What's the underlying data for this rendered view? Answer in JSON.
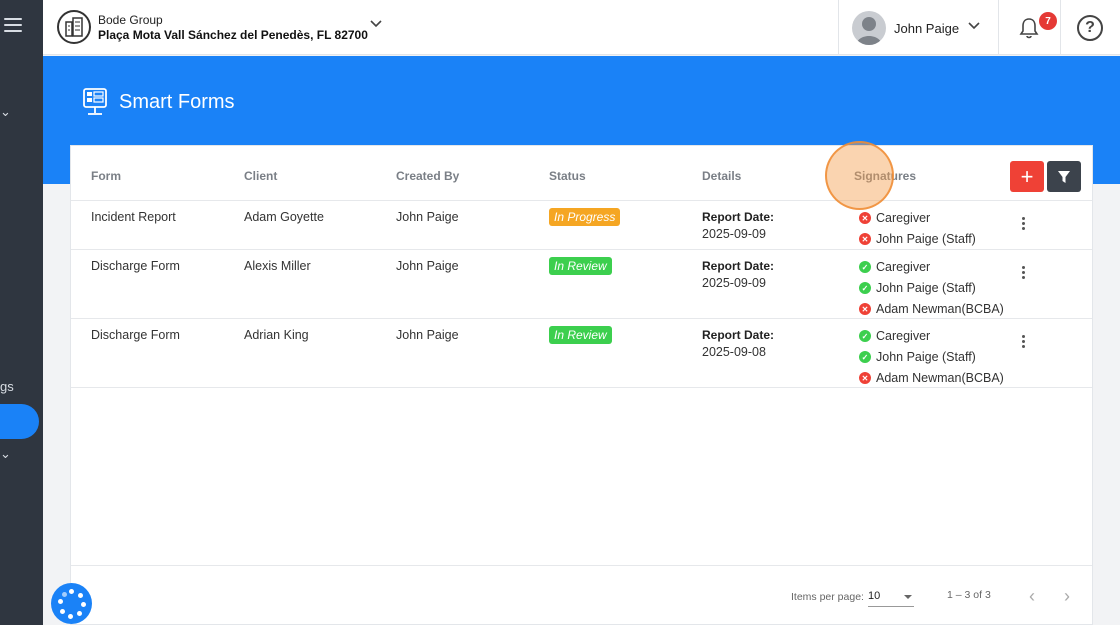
{
  "org": {
    "name": "Bode Group",
    "address": "Plaça Mota Vall Sánchez del Penedès, FL 82700"
  },
  "user": {
    "name": "John Paige"
  },
  "notifications": {
    "count": "7"
  },
  "help": {
    "symbol": "?"
  },
  "sidebar": {
    "partial_label": "gs"
  },
  "page": {
    "title": "Smart Forms",
    "icon": "form-screen-icon"
  },
  "table": {
    "headers": {
      "form": "Form",
      "client": "Client",
      "created_by": "Created By",
      "status": "Status",
      "details": "Details",
      "signatures": "Signatures"
    },
    "add_symbol": "+",
    "rows": [
      {
        "form": "Incident Report",
        "client": "Adam Goyette",
        "created_by": "John Paige",
        "status": "In Progress",
        "detail_label": "Report Date:",
        "detail_value": "2025-09-09",
        "signatures": [
          {
            "name": "Caregiver",
            "signed": false
          },
          {
            "name": "John Paige (Staff)",
            "signed": false
          }
        ]
      },
      {
        "form": "Discharge Form",
        "client": "Alexis Miller",
        "created_by": "John Paige",
        "status": "In Review",
        "detail_label": "Report Date:",
        "detail_value": "2025-09-09",
        "signatures": [
          {
            "name": "Caregiver",
            "signed": true
          },
          {
            "name": "John Paige (Staff)",
            "signed": true
          },
          {
            "name": "Adam Newman(BCBA)",
            "signed": false
          }
        ]
      },
      {
        "form": "Discharge Form",
        "client": "Adrian King",
        "created_by": "John Paige",
        "status": "In Review",
        "detail_label": "Report Date:",
        "detail_value": "2025-09-08",
        "signatures": [
          {
            "name": "Caregiver",
            "signed": true
          },
          {
            "name": "John Paige (Staff)",
            "signed": true
          },
          {
            "name": "Adam Newman(BCBA)",
            "signed": false
          }
        ]
      }
    ]
  },
  "pagination": {
    "items_per_page_label": "Items per page:",
    "items_per_page": "10",
    "range": "1 – 3 of 3",
    "prev": "‹",
    "next": "›"
  },
  "colors": {
    "primary": "#1a82f7",
    "sidebar": "#2f3640",
    "danger": "#ef4136",
    "success": "#3ccf4e",
    "warning": "#f5a623"
  }
}
